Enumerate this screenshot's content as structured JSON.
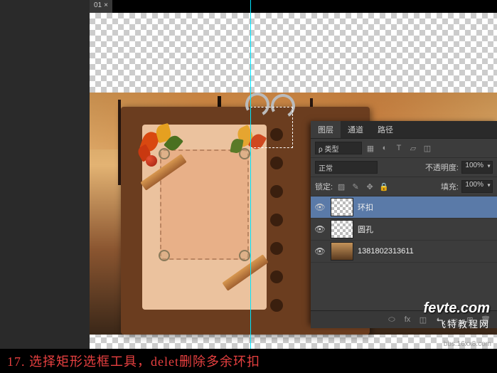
{
  "doc": {
    "tab": "01",
    "close": "×"
  },
  "panel": {
    "tabs": {
      "layers": "图层",
      "channels": "通道",
      "paths": "路径"
    },
    "typerow": {
      "label": "ρ 类型",
      "icons": [
        "img-icon",
        "adj-icon",
        "type-icon",
        "shape-icon",
        "smart-icon"
      ]
    },
    "blendrow": {
      "mode": "正常",
      "opacity_label": "不透明度:",
      "opacity": "100%"
    },
    "lockrow": {
      "label": "锁定:",
      "fill_label": "填充:",
      "fill": "100%"
    },
    "layers": [
      {
        "name": "环扣",
        "thumb": "trans",
        "visible": true,
        "selected": true
      },
      {
        "name": "圆孔",
        "thumb": "trans",
        "visible": true,
        "selected": false
      },
      {
        "name": "1381802313611",
        "thumb": "img",
        "visible": true,
        "selected": false
      }
    ],
    "footer": [
      "link-icon",
      "fx-icon",
      "mask-icon",
      "adjust-icon",
      "group-icon",
      "new-icon",
      "trash-icon"
    ]
  },
  "watermark": {
    "line1": "fevte.com",
    "line2": "飞特教程网",
    "line3": "bbs.16xx8.com"
  },
  "caption": "17. 选择矩形选框工具，delet删除多余环扣"
}
